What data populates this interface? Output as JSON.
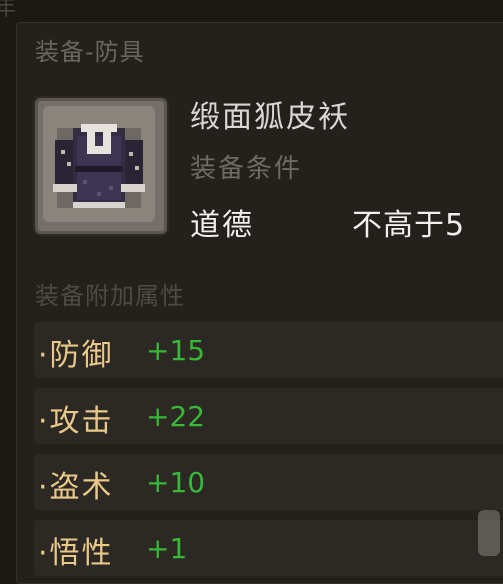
{
  "corner_glyph": "年",
  "category": "装备-防具",
  "item": {
    "name": "缎面狐皮袄",
    "icon": "robe-icon"
  },
  "requirement": {
    "label": "装备条件",
    "stat": "道德",
    "value": "不高于5"
  },
  "attributes": {
    "header": "装备附加属性",
    "rows": [
      {
        "name": "·防御",
        "value": "+15"
      },
      {
        "name": "·攻击",
        "value": "+22"
      },
      {
        "name": "·盗术",
        "value": "+10"
      },
      {
        "name": "·悟性",
        "value": "+1"
      }
    ]
  },
  "colors": {
    "attr_name": "#e8c98a",
    "attr_value": "#38b838"
  }
}
